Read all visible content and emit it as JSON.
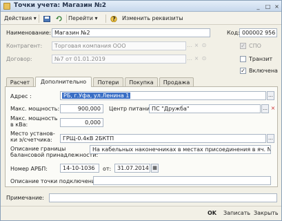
{
  "window": {
    "title": "Точки учета: Магазин №2"
  },
  "toolbar": {
    "actions": "Действия",
    "goto": "Перейти",
    "help_icon": "?",
    "change": "Изменить реквизиты"
  },
  "header": {
    "name_label": "Наименование:",
    "name_value": "Магазин №2",
    "code_label": "Код:",
    "code_value": "000002 956",
    "contractor_label": "Контрагент:",
    "contractor_value": "Торговая компания ООО",
    "spo_label": "СПО",
    "contract_label": "Договор:",
    "contract_value": "№7 от 01.01.2019",
    "transit_label": "Транзит",
    "enabled_label": "Включена"
  },
  "tabs": [
    "Расчет",
    "Дополнительно",
    "Потери",
    "Покупка",
    "Продажа"
  ],
  "panel": {
    "address_label": "Адрес :",
    "address_value": "РБ, г.Уфа, ул.Ленина 1",
    "max_power_label": "Макс. мощность:",
    "max_power_value": "900,000",
    "power_center_label": "Центр питания:",
    "power_center_value": "ПС \"Дружба\"",
    "max_power_kva_label_1": "Макс. мощность",
    "max_power_kva_label_2": "в кВа:",
    "max_power_kva_value": "0,000",
    "place_label_1": "Место установ-",
    "place_label_2": "ки э/счетчика:",
    "place_value": "ГРЩ-0.4кВ 2БКТП",
    "boundary_label_1": "Описание границы",
    "boundary_label_2": "балансовой принадлежности:",
    "boundary_value": "На кабельных наконечниках в местах присоединения в яч. N=2, яч. N=",
    "arbp_label": "Номер АРБП:",
    "arbp_value": "14-10-1036",
    "from_label": "от:",
    "from_value": "31.07.2014",
    "connection_label": "Описание точки подключения:",
    "connection_value": ""
  },
  "footer": {
    "note_label": "Примечание:",
    "note_value": "",
    "ok": "OK",
    "save": "Записать",
    "close": "Закрыть"
  },
  "checkboxes": {
    "spo": false,
    "transit": false,
    "enabled": true
  }
}
